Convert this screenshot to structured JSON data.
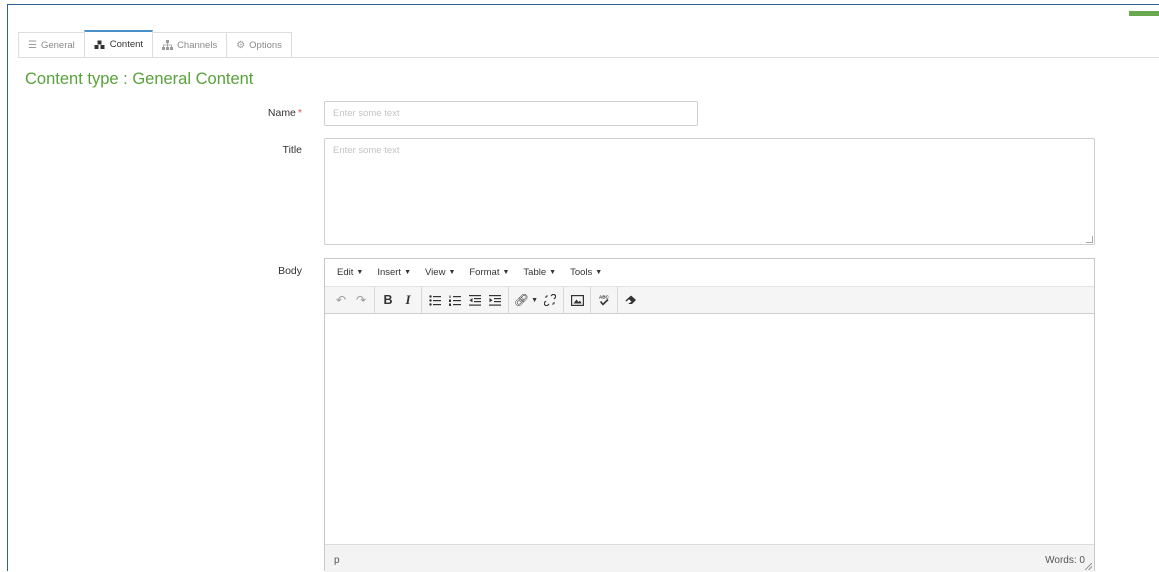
{
  "tabs": [
    {
      "label": "General",
      "icon": "sliders-icon"
    },
    {
      "label": "Content",
      "icon": "cubes-icon"
    },
    {
      "label": "Channels",
      "icon": "sitemap-icon"
    },
    {
      "label": "Options",
      "icon": "cogs-icon"
    }
  ],
  "active_tab": "Content",
  "content_type_title": "Content type : General Content",
  "fields": {
    "name": {
      "label": "Name",
      "required_marker": "*",
      "placeholder": "Enter some text",
      "value": ""
    },
    "title": {
      "label": "Title",
      "placeholder": "Enter some text",
      "value": ""
    },
    "body": {
      "label": "Body"
    }
  },
  "editor": {
    "menus": [
      "Edit",
      "Insert",
      "View",
      "Format",
      "Table",
      "Tools"
    ],
    "toolbar_icons": [
      "undo-icon",
      "redo-icon",
      "bold-icon",
      "italic-icon",
      "bullet-list-icon",
      "numbered-list-icon",
      "outdent-icon",
      "indent-icon",
      "link-icon",
      "unlink-icon",
      "image-icon",
      "spellcheck-icon",
      "eraser-icon"
    ],
    "status_path": "p",
    "word_count": "Words: 0"
  },
  "colors": {
    "accent_green": "#58a23a",
    "active_tab_border": "#4a90c9",
    "required": "#d9534f"
  }
}
